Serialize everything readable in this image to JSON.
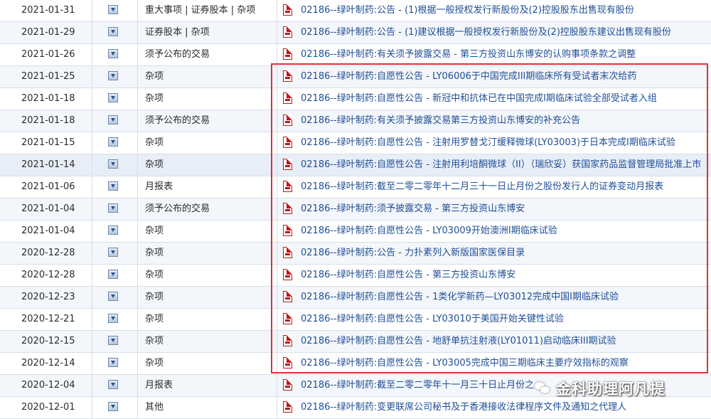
{
  "rows": [
    {
      "date": "2021-01-31",
      "category": "重大事项 | 证券股本 | 杂项",
      "title": "02186--绿叶制药:公告 - (1)根据一般授权发行新股份及(2)控股股东出售现有股份"
    },
    {
      "date": "2021-01-29",
      "category": "证券股本 | 杂项",
      "title": "02186--绿叶制药:公告 - (1)建议根据一般授权发行新股份及(2)控股股东建议出售现有股份"
    },
    {
      "date": "2021-01-26",
      "category": "须予公布的交易",
      "title": "02186--绿叶制药:有关须予披露交易 - 第三方投资山东博安的认购事项条款之调整"
    },
    {
      "date": "2021-01-25",
      "category": "杂项",
      "title": "02186--绿叶制药:自愿性公告 - LY06006于中国完成III期临床所有受试者末次给药"
    },
    {
      "date": "2021-01-18",
      "category": "杂项",
      "title": "02186--绿叶制药:自愿性公告 - 新冠中和抗体已在中国完成I期临床试验全部受试者入组"
    },
    {
      "date": "2021-01-18",
      "category": "须予公布的交易",
      "title": "02186--绿叶制药:有关须予披露交易第三方投资山东博安的补充公告"
    },
    {
      "date": "2021-01-15",
      "category": "杂项",
      "title": "02186--绿叶制药:自愿性公告 - 注射用罗替戈汀缓释微球(LY03003)于日本完成I期临床试验"
    },
    {
      "date": "2021-01-14",
      "category": "杂项",
      "title": "02186--绿叶制药:自愿性公告 - 注射用利培酮微球（II）（瑞欣妥）获国家药品监督管理局批准上市"
    },
    {
      "date": "2021-01-06",
      "category": "月报表",
      "title": "02186--绿叶制药:截至二零二零年十二月三十一日止月份之股份发行人的证券变动月报表"
    },
    {
      "date": "2021-01-04",
      "category": "须予公布的交易",
      "title": "02186--绿叶制药:须予披露交易 - 第三方投资山东博安"
    },
    {
      "date": "2021-01-04",
      "category": "杂项",
      "title": "02186--绿叶制药:自愿性公告 - LY03009开始澳洲I期临床试验"
    },
    {
      "date": "2020-12-28",
      "category": "杂项",
      "title": "02186--绿叶制药:公告 - 力扑素列入新版国家医保目录"
    },
    {
      "date": "2020-12-28",
      "category": "杂项",
      "title": "02186--绿叶制药:自愿性公告 - 第三方投资山东博安"
    },
    {
      "date": "2020-12-23",
      "category": "杂项",
      "title": "02186--绿叶制药:自愿性公告 - 1类化学新药—LY03012完成中国I期临床试验"
    },
    {
      "date": "2020-12-21",
      "category": "杂项",
      "title": "02186--绿叶制药:自愿性公告 - LY03010于美国开始关键性试验"
    },
    {
      "date": "2020-12-15",
      "category": "杂项",
      "title": "02186--绿叶制药:自愿性公告 - 地舒单抗注射液(LY01011)启动临床III期试验"
    },
    {
      "date": "2020-12-14",
      "category": "杂项",
      "title": "02186--绿叶制药:自愿性公告 - LY03005完成中国三期临床主要疗效指标的观察"
    },
    {
      "date": "2020-12-04",
      "category": "月报表",
      "title": "02186--绿叶制药:截至二零二零年十一月三十日止月份之"
    },
    {
      "date": "2020-12-01",
      "category": "其他",
      "title": "02186--绿叶制药:变更联席公司秘书及于香港接收法律程序文件及通知之代理人"
    }
  ],
  "highlighted_row_index": 7,
  "watermark": {
    "text": "金科助理阿凡提",
    "icon": "wechat-icon"
  },
  "colors": {
    "link": "#1f4e96",
    "highlight_box": "#d0353a",
    "row_alt": "#f3f6fa",
    "row_selected": "#e8eef8"
  }
}
